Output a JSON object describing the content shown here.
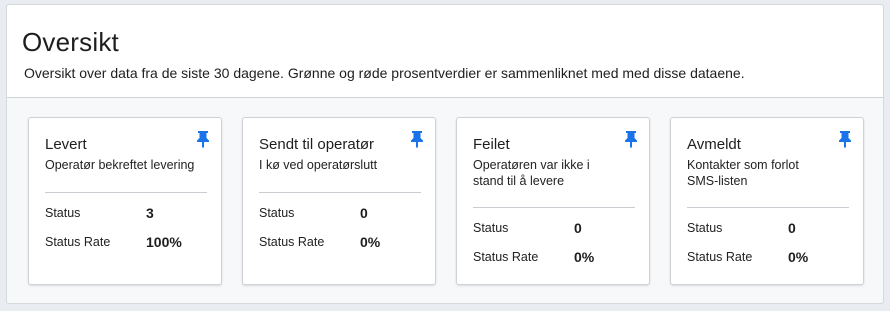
{
  "header": {
    "title": "Oversikt",
    "subtitle": "Oversikt over data fra de siste 30 dagene. Grønne og røde prosentverdier er sammenliknet med med disse dataene."
  },
  "labels": {
    "status": "Status",
    "status_rate": "Status Rate"
  },
  "cards": [
    {
      "title": "Levert",
      "description": "Operatør bekreftet levering",
      "status": "3",
      "status_rate": "100%"
    },
    {
      "title": "Sendt til operatør",
      "description": "I kø ved operatørslutt",
      "status": "0",
      "status_rate": "0%"
    },
    {
      "title": "Feilet",
      "description": "Operatøren var ikke i stand til å levere",
      "status": "0",
      "status_rate": "0%"
    },
    {
      "title": "Avmeldt",
      "description": "Kontakter som forlot SMS-listen",
      "status": "0",
      "status_rate": "0%"
    }
  ],
  "icons": {
    "pin": "pin-icon"
  },
  "colors": {
    "pin": "#1a73e8"
  }
}
